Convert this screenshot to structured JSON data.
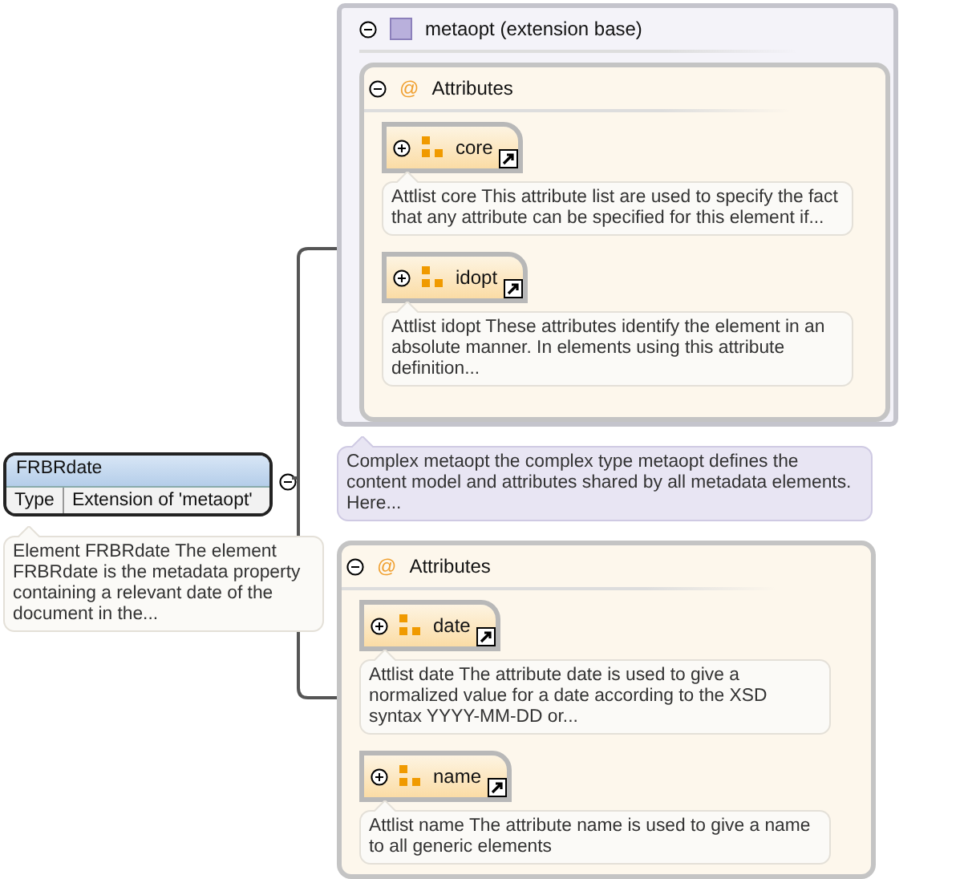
{
  "element": {
    "name": "FRBRdate",
    "type_label": "Type",
    "type_value": "Extension of 'metaopt'",
    "expanded": true,
    "annotation": "Element FRBRdate The element FRBRdate is the metadata property containing a relevant date of the document in the..."
  },
  "extension": {
    "name": "metaopt (extension base)",
    "expanded": true,
    "annotation": "Complex metaopt the complex type metaopt defines the content model and attributes shared by all metadata elements. Here...",
    "attributes": {
      "symbol": "@",
      "title": "Attributes",
      "expanded": true,
      "items": [
        {
          "name": "core",
          "expanded": false,
          "annotation": "Attlist core This attribute list are used to specify the fact that any attribute can be specified for this element if..."
        },
        {
          "name": "idopt",
          "expanded": false,
          "annotation": "Attlist idopt These attributes identify the element in an absolute manner. In elements using this attribute definition..."
        }
      ]
    }
  },
  "attributes": {
    "symbol": "@",
    "title": "Attributes",
    "expanded": true,
    "items": [
      {
        "name": "date",
        "expanded": false,
        "annotation": "Attlist date The attribute date is used to give a normalized value for a date according to the XSD syntax YYYY-MM-DD or..."
      },
      {
        "name": "name",
        "expanded": false,
        "annotation": "Attlist name The attribute name is used to give a name to all generic elements"
      }
    ]
  }
}
